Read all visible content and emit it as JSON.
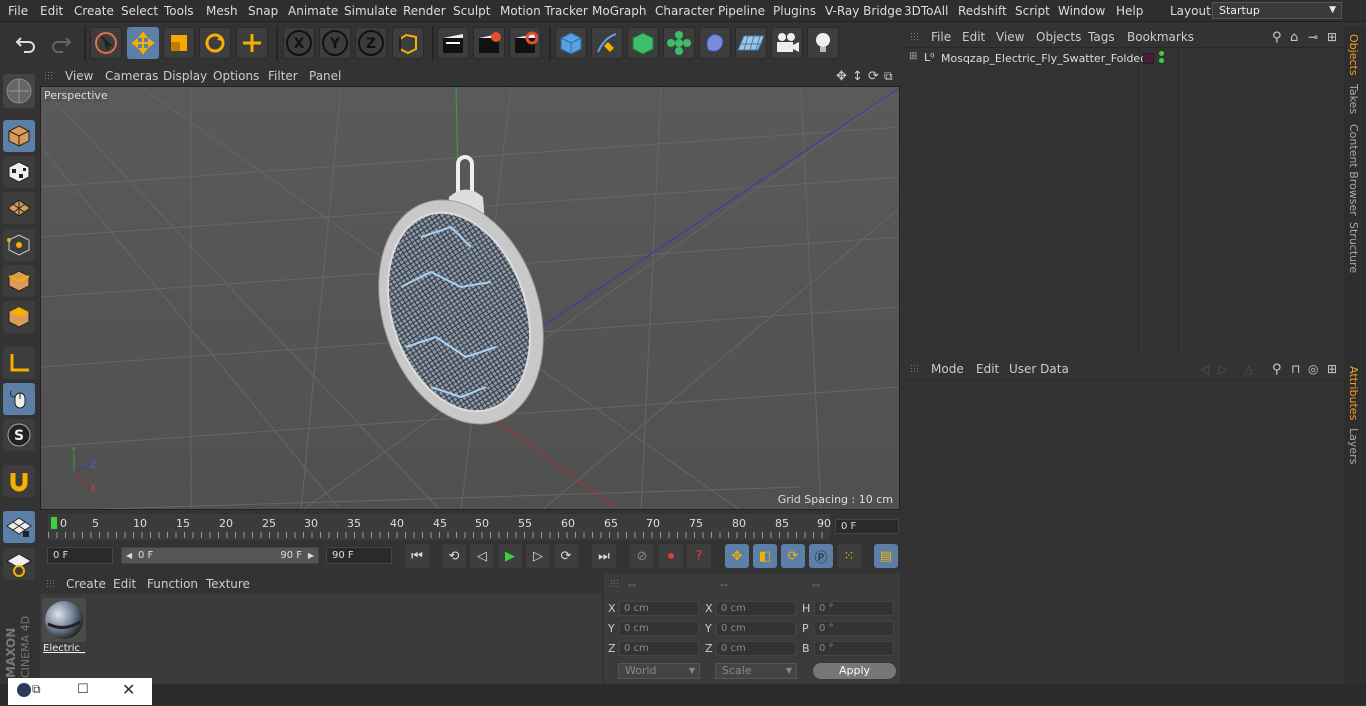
{
  "menubar": {
    "items": [
      "File",
      "Edit",
      "Create",
      "Select",
      "Tools",
      "Mesh",
      "Snap",
      "Animate",
      "Simulate",
      "Render",
      "Sculpt",
      "Motion Tracker",
      "MoGraph",
      "Character",
      "Pipeline",
      "Plugins",
      "V-Ray Bridge",
      "3DToAll",
      "Redshift",
      "Script",
      "Window",
      "Help"
    ],
    "layout_label": "Layout:",
    "layout_value": "Startup"
  },
  "toolbar": {
    "icons": [
      "undo-icon",
      "redo-icon",
      "live-selection-icon",
      "move-icon",
      "scale-icon",
      "rotate-icon",
      "transform-icon",
      "x-axis-icon",
      "y-axis-icon",
      "z-axis-icon",
      "world-coordinates-icon",
      "render-view-icon",
      "render-picture-viewer-icon",
      "render-settings-icon",
      "cube-icon",
      "pen-icon",
      "subdivision-icon",
      "cloner-icon",
      "deformer-icon",
      "floor-icon",
      "camera-icon",
      "light-icon"
    ],
    "axis_labels": [
      "X",
      "Y",
      "Z"
    ]
  },
  "viewport": {
    "menu": [
      "View",
      "Cameras",
      "Display",
      "Options",
      "Filter",
      "Panel"
    ],
    "label": "Perspective",
    "grid_spacing": "Grid Spacing : 10 cm"
  },
  "timeline": {
    "ticks": [
      "0",
      "5",
      "10",
      "15",
      "20",
      "25",
      "30",
      "35",
      "40",
      "45",
      "50",
      "55",
      "60",
      "65",
      "70",
      "75",
      "80",
      "85",
      "90"
    ],
    "current_frame": "0 F",
    "start_field": "0 F",
    "range_start": "0 F",
    "range_end": "90 F",
    "end_field": "90 F"
  },
  "material_manager": {
    "menu": [
      "Create",
      "Edit",
      "Function",
      "Texture"
    ],
    "material_name": "Electric_"
  },
  "coordinates": {
    "headers": [
      "--",
      "--",
      "--"
    ],
    "rows": [
      {
        "l1": "X",
        "v1": "0 cm",
        "l2": "X",
        "v2": "0 cm",
        "l3": "H",
        "v3": "0 °"
      },
      {
        "l1": "Y",
        "v1": "0 cm",
        "l2": "Y",
        "v2": "0 cm",
        "l3": "P",
        "v3": "0 °"
      },
      {
        "l1": "Z",
        "v1": "0 cm",
        "l2": "Z",
        "v2": "0 cm",
        "l3": "B",
        "v3": "0 °"
      }
    ],
    "mode_select": "World",
    "scale_select": "Scale",
    "apply_label": "Apply"
  },
  "object_manager": {
    "menu": [
      "File",
      "Edit",
      "View",
      "Objects",
      "Tags",
      "Bookmarks"
    ],
    "object_name": "Mosqzap_Electric_Fly_Swatter_Folded"
  },
  "attribute_manager": {
    "menu": [
      "Mode",
      "Edit",
      "User Data"
    ]
  },
  "right_tabs": [
    "Objects",
    "Takes",
    "Content Browser",
    "Structure",
    "Attributes",
    "Layers"
  ],
  "logo": {
    "line1": "MAXON",
    "line2": "CINEMA 4D"
  },
  "colors": {
    "accent": "#5b7fa6",
    "active_tab": "#f0a030",
    "play_green": "#3cd23c",
    "record_red": "#e03b3b"
  }
}
